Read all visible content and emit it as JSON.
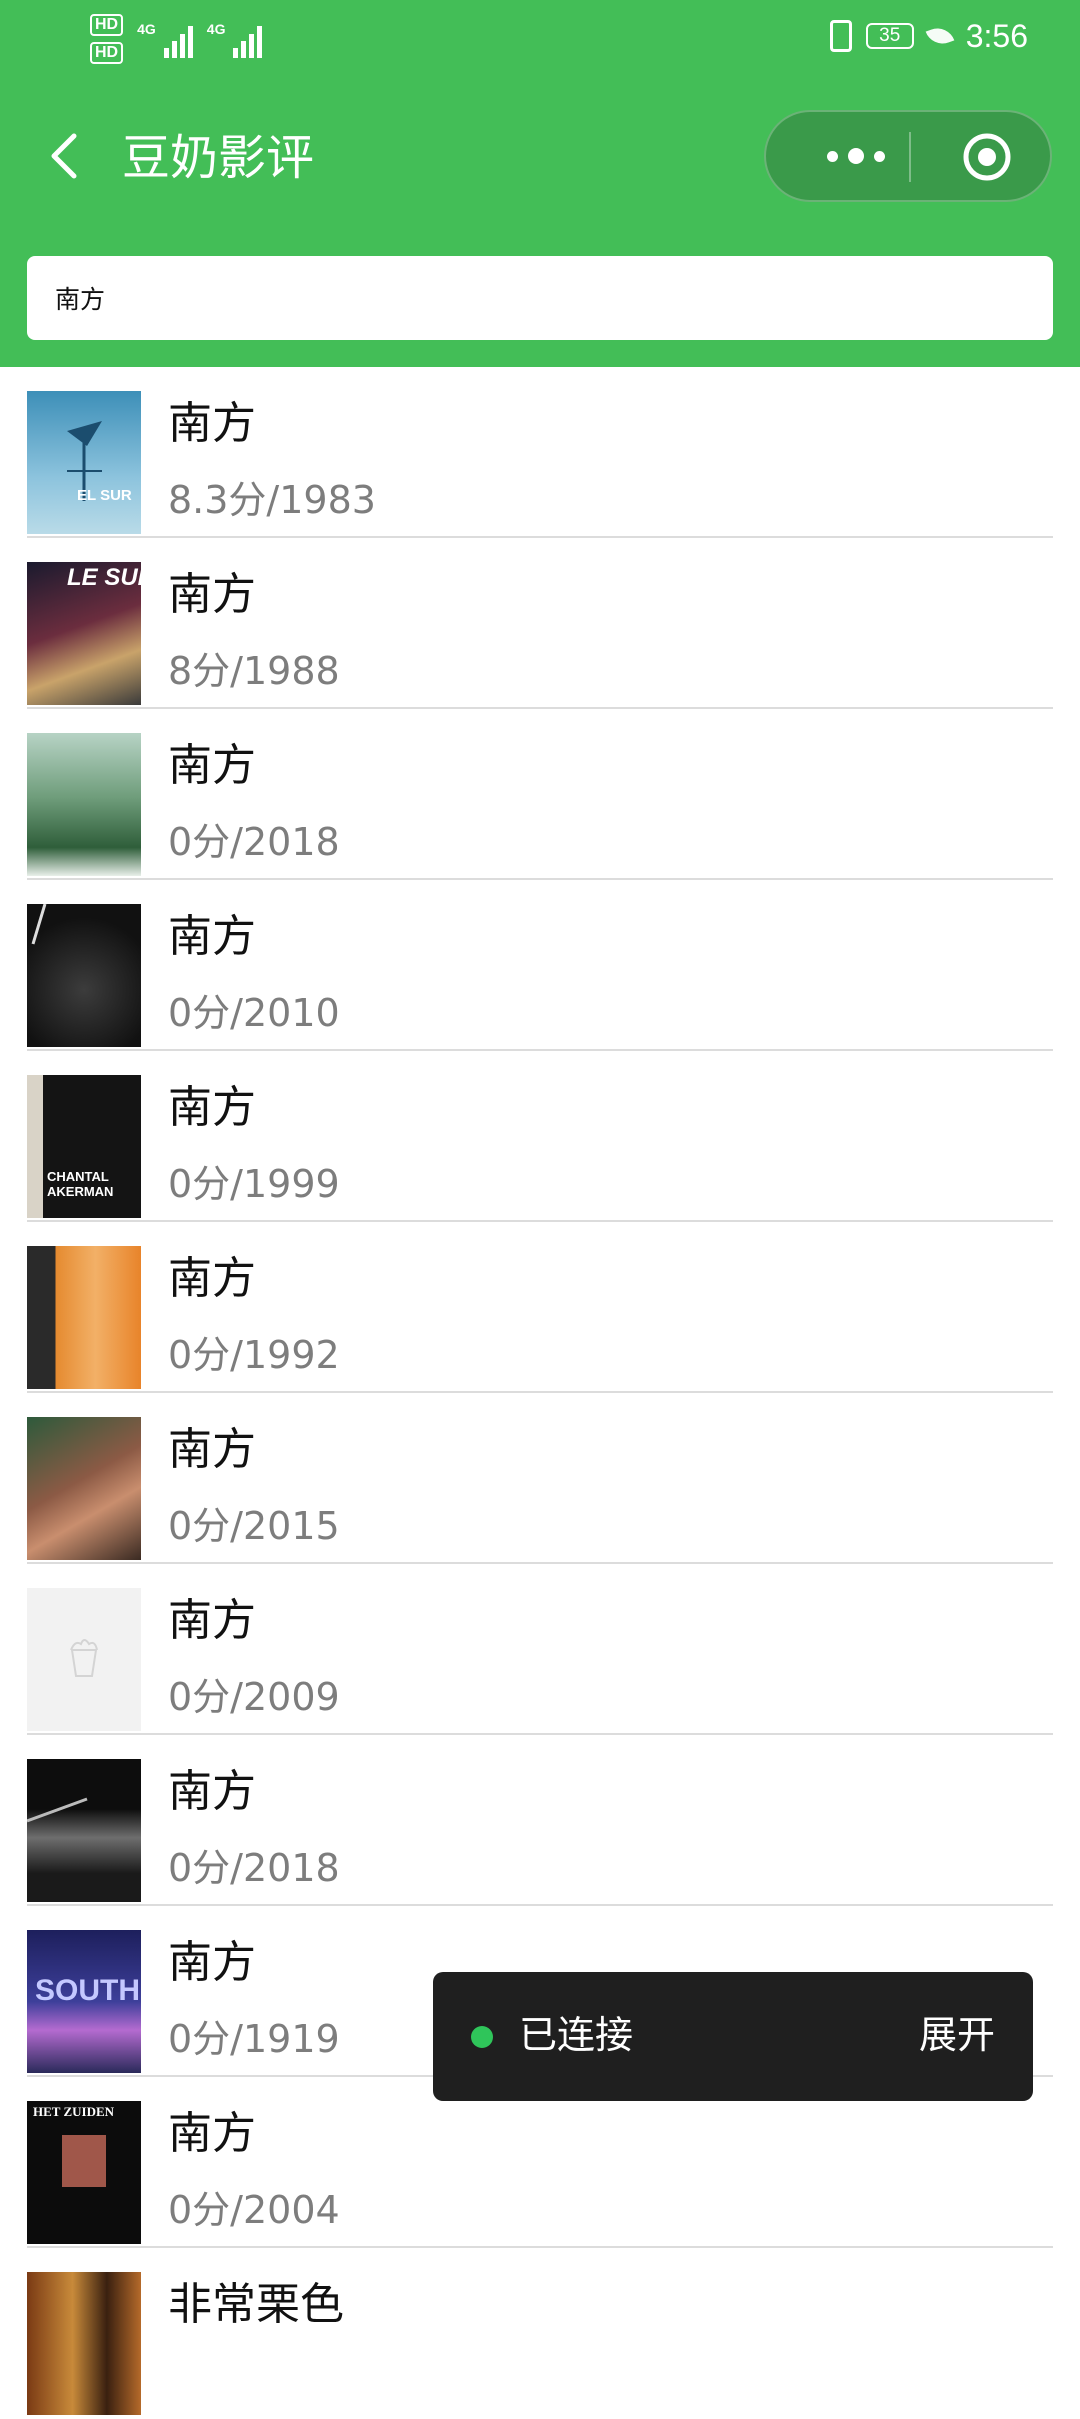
{
  "status_bar": {
    "hd1": "HD",
    "hd2": "HD",
    "net1": "4G",
    "net2": "4G",
    "battery": "35",
    "time": "3:56"
  },
  "nav": {
    "title": "豆奶影评"
  },
  "search": {
    "value": "南方"
  },
  "results": [
    {
      "title": "南方",
      "meta": "8.3分/1983",
      "poster_text": "EL SUR"
    },
    {
      "title": "南方",
      "meta": "8分/1988",
      "poster_text": "LE SUD"
    },
    {
      "title": "南方",
      "meta": "0分/2018",
      "poster_text": ""
    },
    {
      "title": "南方",
      "meta": "0分/2010",
      "poster_text": ""
    },
    {
      "title": "南方",
      "meta": "0分/1999",
      "poster_text": "CHANTAL AKERMAN"
    },
    {
      "title": "南方",
      "meta": "0分/1992",
      "poster_text": ""
    },
    {
      "title": "南方",
      "meta": "0分/2015",
      "poster_text": ""
    },
    {
      "title": "南方",
      "meta": "0分/2009",
      "poster_text": ""
    },
    {
      "title": "南方",
      "meta": "0分/2018",
      "poster_text": ""
    },
    {
      "title": "南方",
      "meta": "0分/1919",
      "poster_text": "SOUTH"
    },
    {
      "title": "南方",
      "meta": "0分/2004",
      "poster_text": "HET ZUIDEN"
    },
    {
      "title": "非常栗色",
      "meta": "",
      "poster_text": ""
    }
  ],
  "toast": {
    "status": "已连接",
    "action": "展开"
  },
  "colors": {
    "brand_green": "#43be57",
    "toast_dot": "#2fc55a"
  }
}
